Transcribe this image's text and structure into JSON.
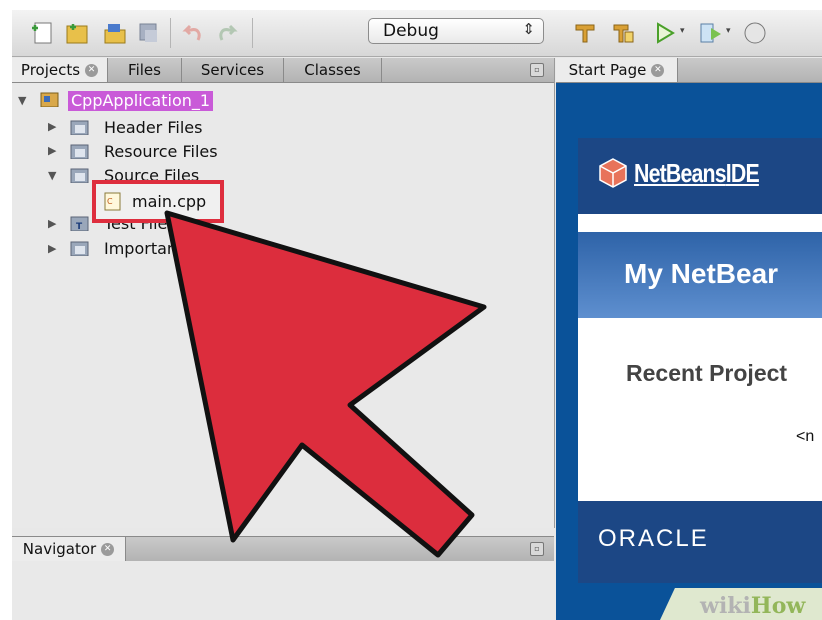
{
  "toolbar": {
    "configuration": "Debug",
    "icons": [
      "new-file-icon",
      "new-project-icon",
      "open-project-icon",
      "close-project-icon",
      "undo-icon",
      "redo-icon",
      "clean-build-icon",
      "build-icon",
      "run-icon",
      "debug-icon"
    ]
  },
  "projects_panel": {
    "tabs": [
      {
        "label": "Projects"
      },
      {
        "label": "Files"
      },
      {
        "label": "Services"
      },
      {
        "label": "Classes"
      }
    ],
    "tree": {
      "project": "CppApplication_1",
      "items": [
        {
          "label": "Header Files"
        },
        {
          "label": "Resource Files"
        },
        {
          "label": "Source Files"
        },
        {
          "label": "main.cpp"
        },
        {
          "label": "Test Files"
        },
        {
          "label": "Important Files"
        }
      ]
    }
  },
  "navigator": {
    "label": "Navigator"
  },
  "editor": {
    "tab": "Start Page",
    "logo_text": "NetBeans",
    "logo_suffix": "IDE",
    "heading": "My NetBear",
    "recent_projects": "Recent Project",
    "no_projects": "<n",
    "footer_logo": "ORACLE"
  },
  "colors": {
    "highlight": "#de2e3e",
    "arrow": "#dc2d3d",
    "project_label": "#c95ad8",
    "start_page_blue": "#1c4785"
  },
  "watermark": {
    "part1": "wiki",
    "part2": "How"
  }
}
